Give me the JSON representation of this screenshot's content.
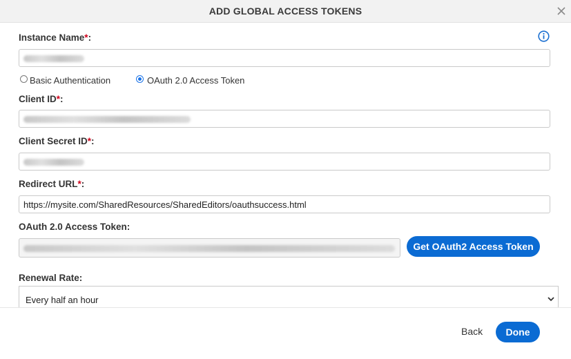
{
  "dialog": {
    "title": "ADD GLOBAL ACCESS TOKENS"
  },
  "form": {
    "instance_name_label": "Instance Name",
    "auth_options": [
      {
        "label": "Basic Authentication",
        "selected": false
      },
      {
        "label": "OAuth 2.0 Access Token",
        "selected": true
      }
    ],
    "client_id_label": "Client ID",
    "client_secret_label": "Client Secret ID",
    "redirect_url_label": "Redirect URL",
    "redirect_url_value": "https://mysite.com/SharedResources/SharedEditors/oauthsuccess.html",
    "access_token_label": "OAuth 2.0 Access Token:",
    "get_token_button": "Get OAuth2 Access Token",
    "renewal_rate_label": "Renewal Rate:",
    "renewal_rate_value": "Every half an hour",
    "required_marker": "*",
    "colon": ":"
  },
  "footer": {
    "back_label": "Back",
    "done_label": "Done"
  },
  "colors": {
    "primary": "#0b6bd3",
    "required": "#d0021b",
    "header_bg": "#f2f2f2"
  },
  "icons": {
    "close": "close-icon",
    "info": "info-icon",
    "dropdown": "chevron-down-icon"
  }
}
